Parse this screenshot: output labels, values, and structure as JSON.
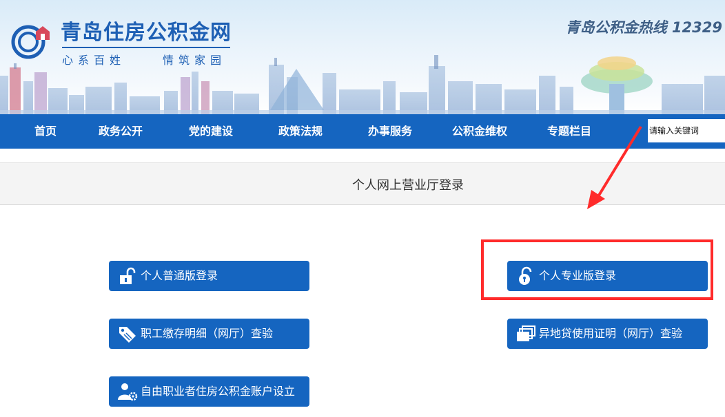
{
  "header": {
    "site_title": "青岛住房公积金网",
    "slogan_left": "心系百姓",
    "slogan_right": "情筑家园",
    "hotline": "青岛公积金热线 12329"
  },
  "nav": {
    "items": [
      {
        "label": "首页"
      },
      {
        "label": "政务公开"
      },
      {
        "label": "党的建设"
      },
      {
        "label": "政策法规"
      },
      {
        "label": "办事服务"
      },
      {
        "label": "公积金维权"
      },
      {
        "label": "专题栏目"
      }
    ]
  },
  "search": {
    "placeholder": "请输入关键词"
  },
  "page": {
    "title": "个人网上营业厅登录"
  },
  "buttons": {
    "personal_basic_login": {
      "label": "个人普通版登录",
      "icon": "unlock-icon"
    },
    "personal_pro_login": {
      "label": "个人专业版登录",
      "icon": "unlock-key-icon"
    },
    "employee_deposit_check": {
      "label": "职工缴存明细（网厅）查验",
      "icon": "tag-icon"
    },
    "offsite_loan_cert_check": {
      "label": "异地贷使用证明（网厅）查验",
      "icon": "documents-stack-icon"
    },
    "freelancer_account_setup": {
      "label": "自由职业者住房公积金账户设立",
      "icon": "user-gear-icon"
    }
  },
  "colors": {
    "brand_blue": "#1565c0",
    "title_blue": "#1d5fb4",
    "annotation_red": "#ff2b2b"
  }
}
